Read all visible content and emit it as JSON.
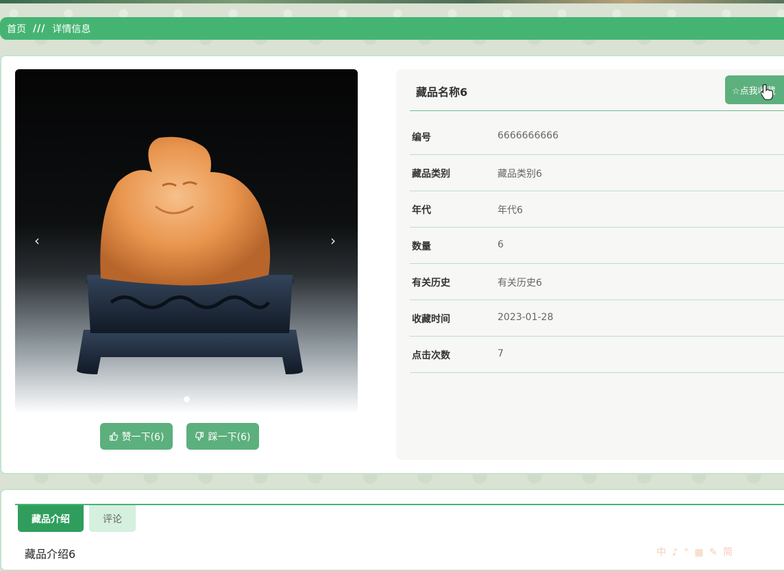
{
  "breadcrumb": {
    "home": "首页",
    "separator": "///",
    "current": "详情信息"
  },
  "gallery": {
    "prev_icon": "‹",
    "next_icon": "›"
  },
  "actions": {
    "like": {
      "icon": "thumbs-up-icon",
      "label": "赞一下(6)"
    },
    "dislike": {
      "icon": "thumbs-down-icon",
      "label": "踩一下(6)"
    }
  },
  "detail": {
    "title": "藏品名称6",
    "favorite_button": "☆点我收藏",
    "fields": [
      {
        "label": "编号",
        "value": "6666666666"
      },
      {
        "label": "藏品类别",
        "value": "藏品类别6"
      },
      {
        "label": "年代",
        "value": "年代6"
      },
      {
        "label": "数量",
        "value": "6"
      },
      {
        "label": "有关历史",
        "value": "有关历史6"
      },
      {
        "label": "收藏时间",
        "value": "2023-01-28"
      },
      {
        "label": "点击次数",
        "value": "7"
      }
    ]
  },
  "tabs": [
    {
      "label": "藏品介绍",
      "active": true
    },
    {
      "label": "评论",
      "active": false
    }
  ],
  "intro_text": "藏品介绍6",
  "ime_toolbar": "中 ♪ ° ▦ ✎ 简",
  "colors": {
    "primary": "#45b472",
    "button": "#5cb07d",
    "tab_active": "#2f9e5c"
  }
}
